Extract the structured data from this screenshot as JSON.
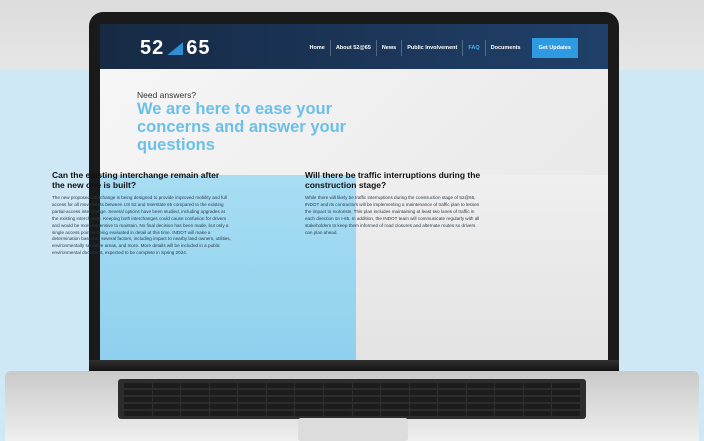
{
  "site": {
    "logo_left": "52",
    "logo_right": "65"
  },
  "nav": {
    "items": [
      "Home",
      "About 52@65",
      "News",
      "Public Involvement",
      "FAQ",
      "Documents"
    ],
    "cta": "Get Updates"
  },
  "hero": {
    "kicker": "Need answers?",
    "headline": "We are here to ease your concerns and answer your questions"
  },
  "faqs": [
    {
      "question": "Can the existing interchange remain after the new one is built?",
      "answer": "The new proposed interchange is being designed to provide improved mobility and full access for all movements between US 52 and Interstate 65 compared to the existing partial-access interchange. Several options have been studied, including upgrades at the existing interchange. Keeping both interchanges could cause confusion for drivers and would be more expensive to maintain. No final decision has been made, but only a single access point is being evaluated in detail at this time. INDOT will make a determination based on several factors, including impact to nearby land owners, utilities, environmentally sensitive areas, and more. More details will be included in a public environmental document, expected to be complete in Spring 2024."
    },
    {
      "question": "Will there be traffic interruptions during the construction stage?",
      "answer": "While there will likely be traffic interruptions during the construction stage of 52@65, INDOT and its contractors will be implementing a maintenance of traffic plan to lessen the impact to motorists. This plan includes maintaining at least two lanes of traffic in each direction on I-65. In addition, the INDOT team will communicate regularly with all stakeholders to keep them informed of road closures and alternate routes so drivers can plan ahead."
    }
  ],
  "colors": {
    "nav_bg": "#1c365a",
    "accent": "#6cc0e7",
    "cta": "#2e9be0",
    "faq_left_bg": "#a8ddf3"
  }
}
